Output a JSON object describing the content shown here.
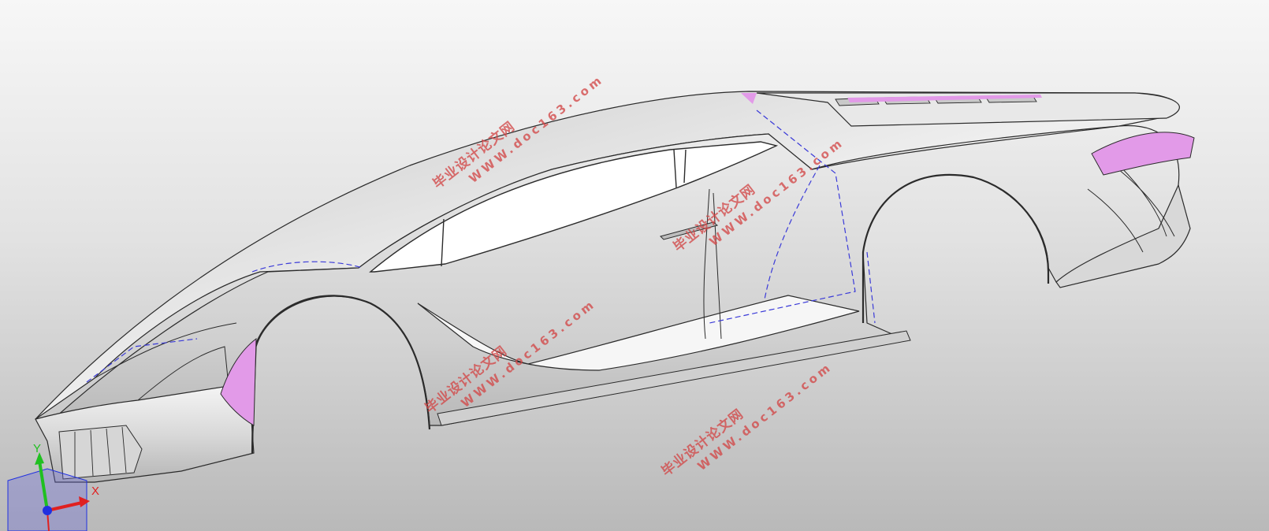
{
  "scene": {
    "background_top": "#f7f7f7",
    "background_bottom": "#b9b9b9",
    "body_color": "#e4e4e4",
    "edge_color": "#2b2b2b",
    "sketch_color": "#3a3ad8",
    "highlight_color": "#e29ae8"
  },
  "watermarks": [
    {
      "line1": "毕业设计论文网",
      "line2": "WWW.doc163.com"
    },
    {
      "line1": "毕业设计论文网",
      "line2": "WWW.doc163.com"
    },
    {
      "line1": "毕业设计论文网",
      "line2": "WWW.doc163.com"
    },
    {
      "line1": "毕业设计论文网",
      "line2": "WWW.doc163.com"
    }
  ],
  "triad": {
    "x_label": "X",
    "y_label": "Y",
    "x_color": "#e02020",
    "y_color": "#20c020",
    "z_color": "#2030e0"
  }
}
